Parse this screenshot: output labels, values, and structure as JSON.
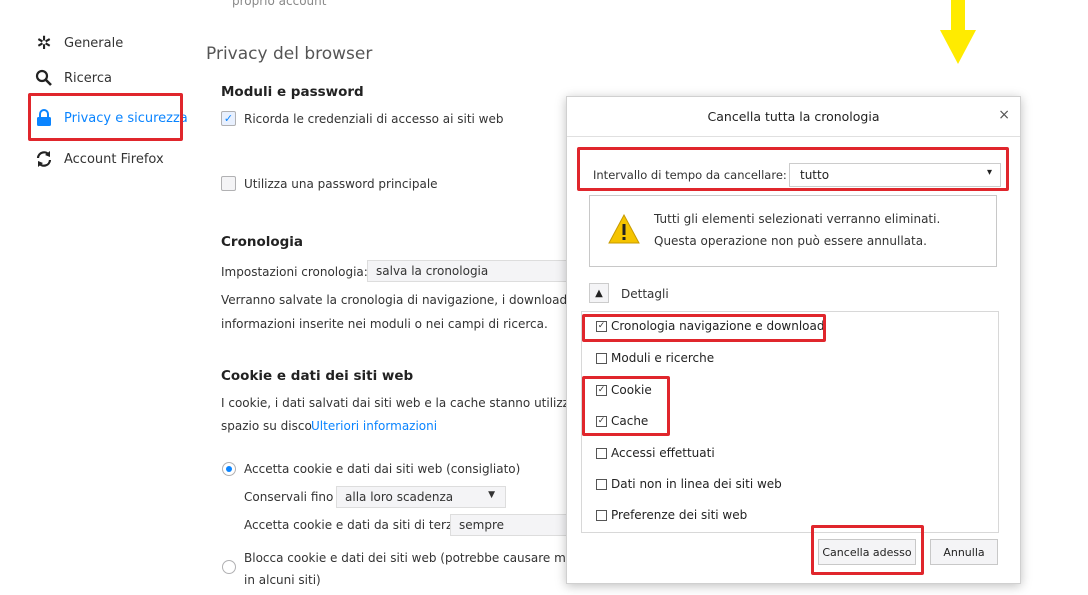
{
  "sidebar": {
    "items": [
      {
        "label": "Generale",
        "icon": "gear-icon"
      },
      {
        "label": "Ricerca",
        "icon": "search-icon"
      },
      {
        "label": "Privacy e sicurezza",
        "icon": "lock-icon"
      },
      {
        "label": "Account Firefox",
        "icon": "sync-icon"
      }
    ]
  },
  "main": {
    "cut_text": "proprio account",
    "section_title": "Privacy del browser",
    "logins": {
      "heading": "Moduli e password",
      "remember_label": "Ricorda le credenziali di accesso ai siti web",
      "master_password_label": "Utilizza una password principale"
    },
    "history": {
      "heading": "Cronologia",
      "settings_label": "Impostazioni cronologia:",
      "settings_value": "salva la cronologia",
      "desc_line1": "Verranno salvate la cronologia di navigazione, i download, le",
      "desc_line2": "informazioni inserite nei moduli o nei campi di ricerca."
    },
    "cookies": {
      "heading": "Cookie e dati dei siti web",
      "desc_line1": "I cookie, i dati salvati dai siti web e la cache stanno utilizzando",
      "desc_line2": "spazio su disco",
      "more_info": "Ulteriori informazioni",
      "accept_label": "Accetta cookie e dati dai siti web (consigliato)",
      "keep_label": "Conservali fino",
      "keep_value": "alla loro scadenza",
      "third_party_label": "Accetta cookie e dati da siti di terze parti",
      "third_party_value": "sempre",
      "block_label_line1": "Blocca cookie e dati dei siti web (potrebbe causare malfun",
      "block_label_line2": "in alcuni siti)"
    }
  },
  "dialog": {
    "title": "Cancella tutta la cronologia",
    "close": "×",
    "range_label": "Intervallo di tempo da cancellare:",
    "range_value": "tutto",
    "warning_line1": "Tutti gli elementi selezionati verranno eliminati.",
    "warning_line2": "Questa operazione non può essere annullata.",
    "details_label": "Dettagli",
    "items": [
      {
        "label": "Cronologia navigazione e download",
        "checked": true
      },
      {
        "label": "Moduli e ricerche",
        "checked": false
      },
      {
        "label": "Cookie",
        "checked": true
      },
      {
        "label": "Cache",
        "checked": true
      },
      {
        "label": "Accessi effettuati",
        "checked": false
      },
      {
        "label": "Dati non in linea dei siti web",
        "checked": false
      },
      {
        "label": "Preferenze dei siti web",
        "checked": false
      }
    ],
    "clear_now": "Cancella adesso",
    "cancel": "Annulla"
  },
  "colors": {
    "accent": "#0a84ff",
    "highlight": "#e0262c",
    "arrow": "#ffeb00"
  }
}
